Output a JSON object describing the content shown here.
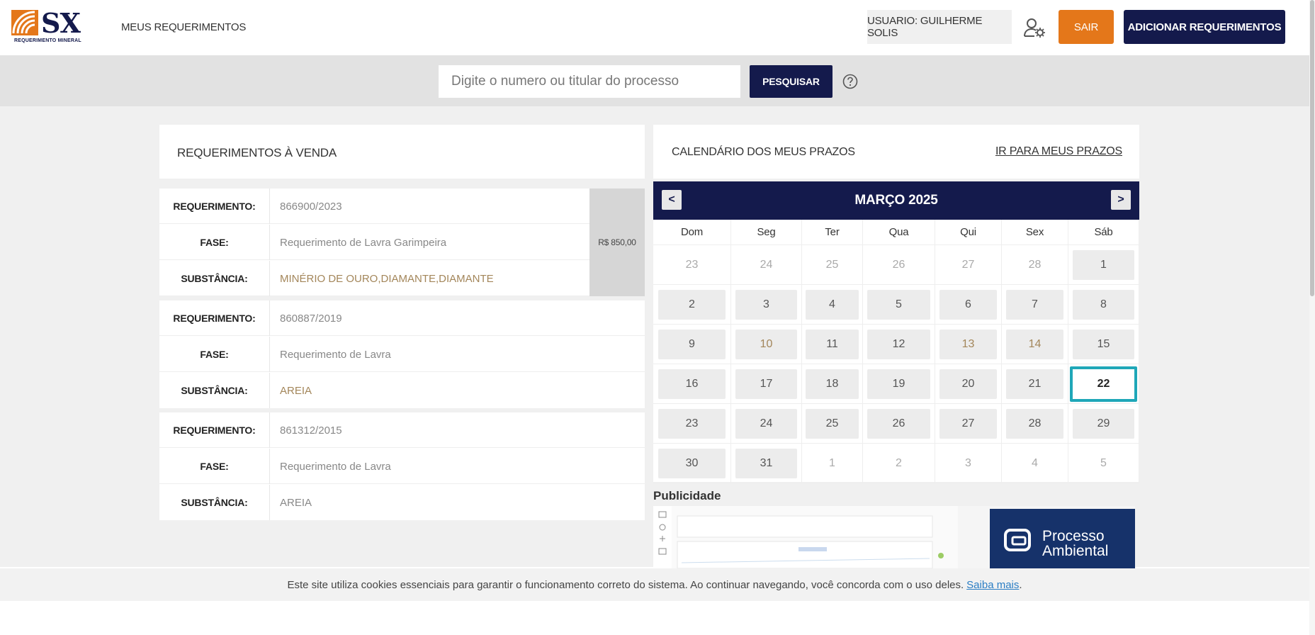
{
  "header": {
    "logo_text": "SX",
    "logo_subtitle": "REQUERIMENTO MINERAL",
    "nav_link": "MEUS REQUERIMENTOS",
    "user_label": "USUARIO: GUILHERME SOLIS",
    "logout_label": "SAIR",
    "add_label": "ADICIONAR REQUERIMENTOS"
  },
  "search": {
    "placeholder": "Digite o numero ou titular do processo",
    "button_label": "PESQUISAR"
  },
  "left_panel": {
    "title": "REQUERIMENTOS À VENDA",
    "field_labels": {
      "req": "REQUERIMENTO:",
      "fase": "FASE:",
      "sub": "SUBSTÂNCIA:"
    },
    "items": [
      {
        "requerimento": "866900/2023",
        "fase": "Requerimento de Lavra Garimpeira",
        "substancia": "MINÉRIO DE OURO,DIAMANTE,DIAMANTE",
        "price": "R$ 850,00"
      },
      {
        "requerimento": "860887/2019",
        "fase": "Requerimento de Lavra",
        "substancia": "AREIA"
      },
      {
        "requerimento": "861312/2015",
        "fase": "Requerimento de Lavra",
        "substancia": "AREIA"
      }
    ]
  },
  "calendar": {
    "title": "CALENDÁRIO DOS MEUS PRAZOS",
    "link_label": "IR PARA MEUS PRAZOS",
    "month_label": "MARÇO 2025",
    "prev": "<",
    "next": ">",
    "weekdays": [
      "Dom",
      "Seg",
      "Ter",
      "Qua",
      "Qui",
      "Sex",
      "Sáb"
    ],
    "weeks": [
      [
        "23",
        "24",
        "25",
        "26",
        "27",
        "28",
        "1"
      ],
      [
        "2",
        "3",
        "4",
        "5",
        "6",
        "7",
        "8"
      ],
      [
        "9",
        "10",
        "11",
        "12",
        "13",
        "14",
        "15"
      ],
      [
        "16",
        "17",
        "18",
        "19",
        "20",
        "21",
        "22"
      ],
      [
        "23",
        "24",
        "25",
        "26",
        "27",
        "28",
        "29"
      ],
      [
        "30",
        "31",
        "1",
        "2",
        "3",
        "4",
        "5"
      ]
    ],
    "today": "22"
  },
  "ads": {
    "title": "Publicidade",
    "brand_line1": "Processo",
    "brand_line2": "Ambiental"
  },
  "cookie": {
    "text": "Este site utiliza cookies essenciais para garantir o funcionamento correto do sistema. Ao continuar navegando, você concorda com o uso deles.",
    "link": "Saiba mais",
    "tail": "."
  },
  "colors": {
    "navy": "#141a4c",
    "orange": "#e4771a",
    "today_border": "#1fa7b8"
  }
}
